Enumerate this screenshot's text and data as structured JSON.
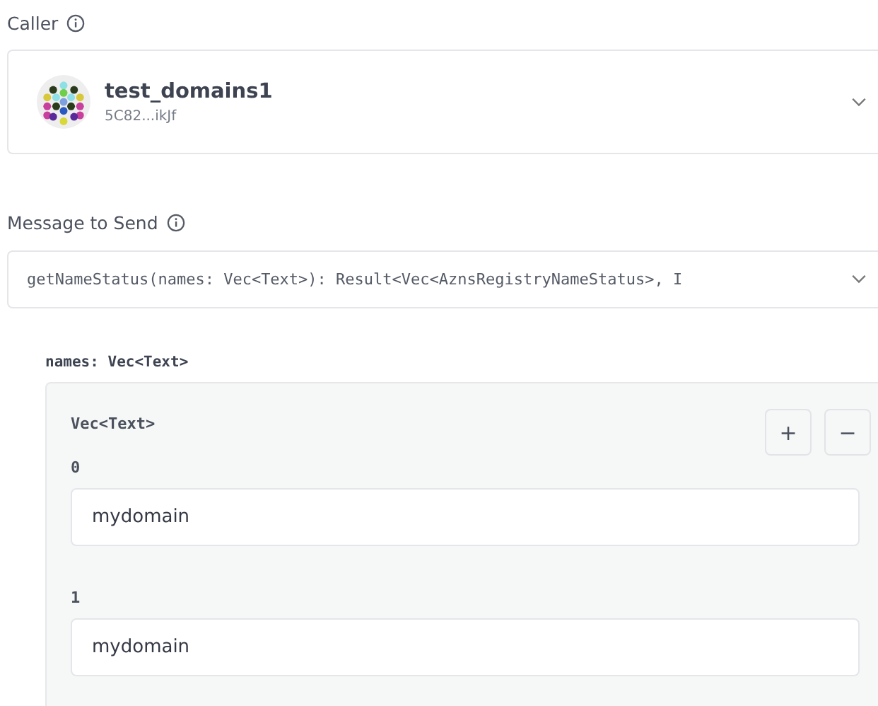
{
  "caller": {
    "label": "Caller",
    "account": {
      "name": "test_domains1",
      "address": "5C82...ikJf"
    }
  },
  "message": {
    "label": "Message to Send",
    "value": "getNameStatus(names: Vec<Text>): Result<Vec<AznsRegistryNameStatus>, I"
  },
  "argument": {
    "label": "names: Vec<Text>",
    "type_label": "Vec<Text>",
    "buttons": [
      "+",
      "−"
    ],
    "items": [
      {
        "index": "0",
        "value": "mydomain"
      },
      {
        "index": "1",
        "value": "mydomain"
      }
    ]
  }
}
